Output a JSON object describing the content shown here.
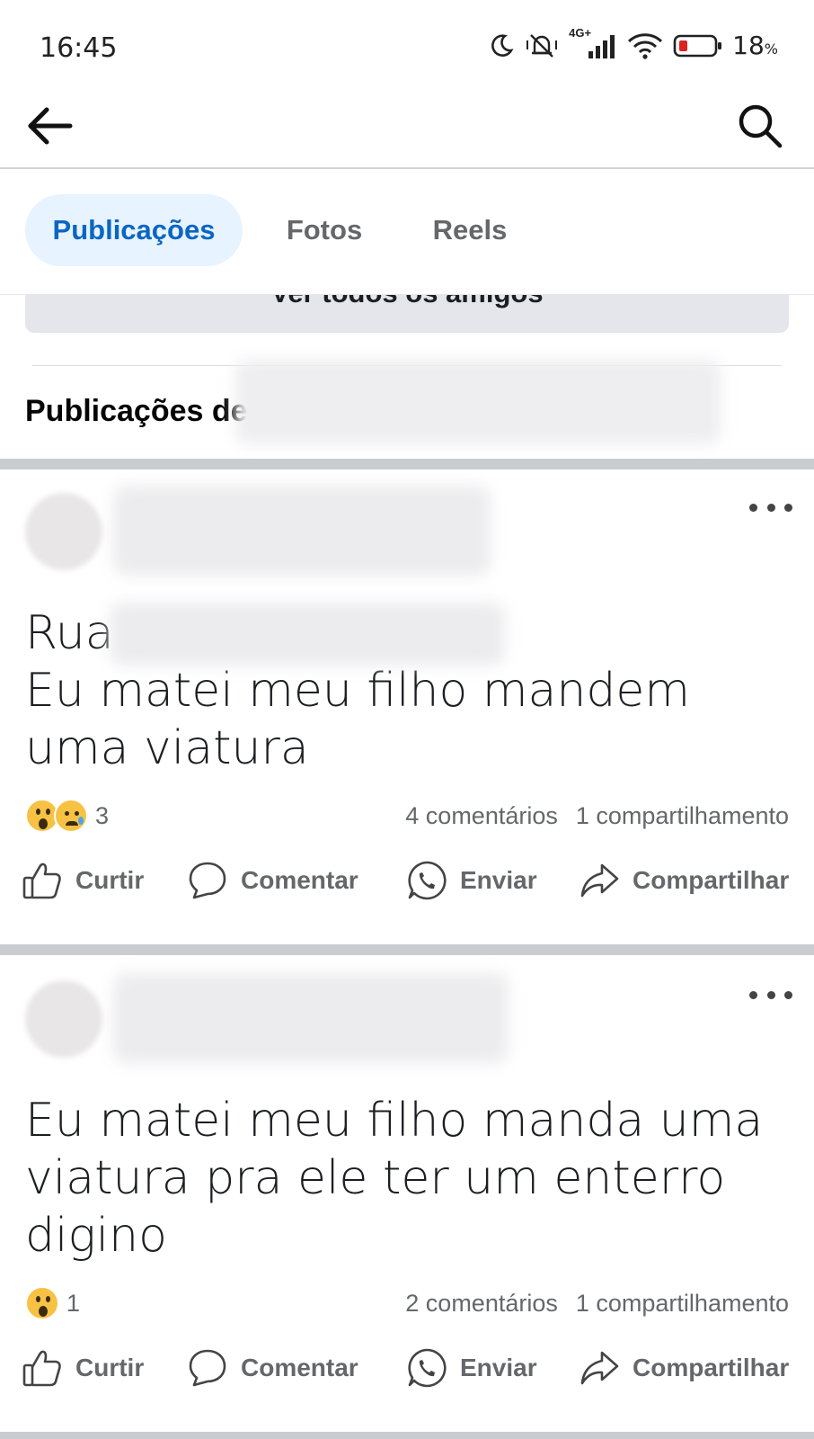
{
  "status_bar": {
    "time": "16:45",
    "network": "4G+",
    "battery_percent": "18",
    "battery_unit": "%",
    "icons": [
      "moon-icon",
      "silent-bell-icon",
      "signal-icon",
      "wifi-icon",
      "battery-icon"
    ]
  },
  "topbar": {
    "back_icon": "arrow-left-icon",
    "search_icon": "search-icon"
  },
  "tabs": [
    {
      "label": "Publicações",
      "active": true
    },
    {
      "label": "Fotos",
      "active": false
    },
    {
      "label": "Reels",
      "active": false
    }
  ],
  "friends_button_label": "Ver todos os amigos",
  "section_title": "Publicações de",
  "posts": [
    {
      "line1": "Rua",
      "text": "Eu matei meu filho mandem uma viatura",
      "reactions": [
        "wow",
        "sad"
      ],
      "reaction_count": "3",
      "comments": "4 comentários",
      "shares": "1 compartilhamento"
    },
    {
      "line1": "",
      "text": "Eu matei meu filho manda uma viatura pra ele ter um enterro digino",
      "reactions": [
        "wow"
      ],
      "reaction_count": "1",
      "comments": "2 comentários",
      "shares": "1 compartilhamento"
    }
  ],
  "actions": {
    "like": "Curtir",
    "comment": "Comentar",
    "send": "Enviar",
    "share": "Compartilhar"
  },
  "colors": {
    "accent": "#0a66c2",
    "active_tab_bg": "#e7f3ff",
    "secondary_text": "#65676b",
    "separator": "#c9ccd1"
  }
}
